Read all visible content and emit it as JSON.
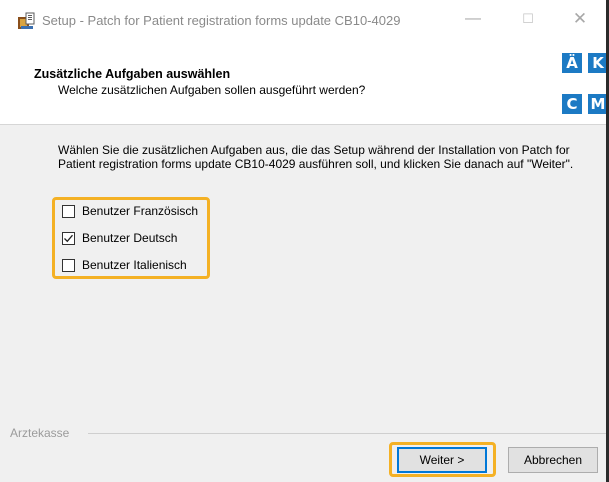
{
  "window": {
    "title": "Setup - Patch for Patient registration forms update CB10-4029",
    "controls": {
      "minimize": "—",
      "maximize": "☐",
      "close": "✕"
    }
  },
  "header": {
    "title": "Zusätzliche Aufgaben auswählen",
    "subtitle": "Welche zusätzlichen Aufgaben sollen ausgeführt werden?",
    "logo": {
      "letters": [
        "Ä",
        "K",
        "C",
        "M"
      ],
      "color": "#1c7ac4"
    }
  },
  "content": {
    "description": "Wählen Sie die zusätzlichen Aufgaben aus, die das Setup während der Installation von Patch for Patient registration forms update CB10-4029 ausführen soll, und klicken Sie danach auf \"Weiter\".",
    "tasks": [
      {
        "label": "Benutzer Französisch",
        "checked": false
      },
      {
        "label": "Benutzer Deutsch",
        "checked": true
      },
      {
        "label": "Benutzer Italienisch",
        "checked": false
      }
    ]
  },
  "footer": {
    "group_label": "Arztekasse",
    "next_label": "Weiter >",
    "cancel_label": "Abbrechen"
  },
  "colors": {
    "highlight": "#f4b125",
    "accent": "#0078d7"
  }
}
